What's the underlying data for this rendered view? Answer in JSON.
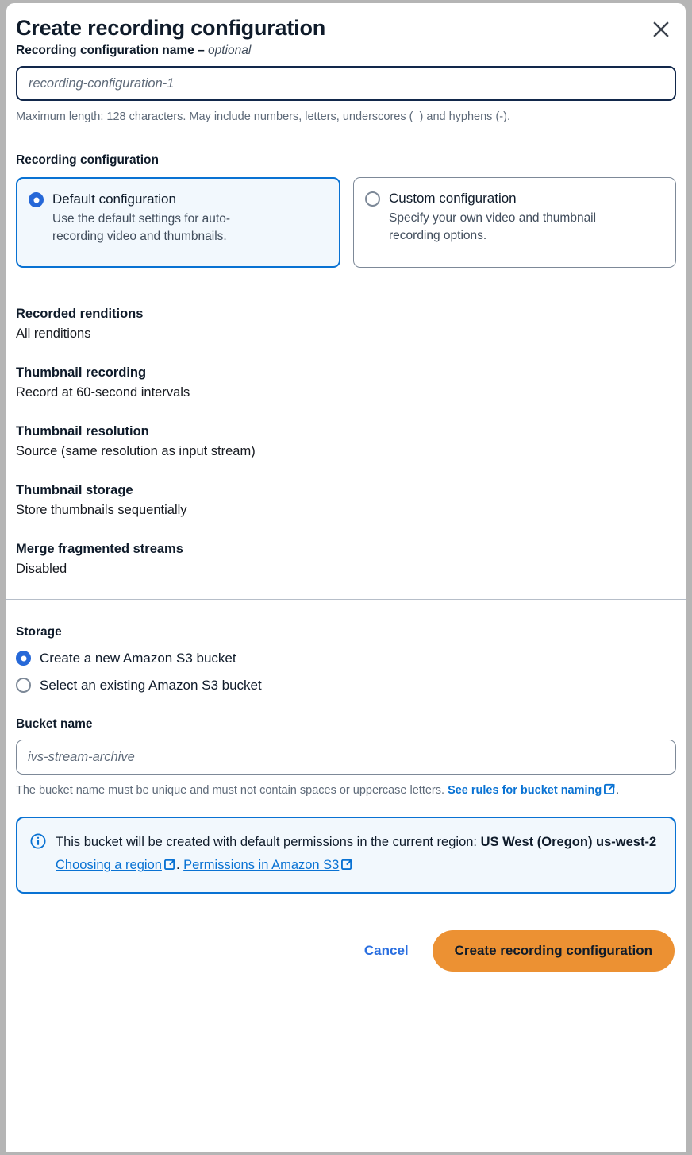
{
  "dialog": {
    "title": "Create recording configuration",
    "close_icon": "close-icon"
  },
  "name_field": {
    "label": "Recording configuration name – ",
    "optional_suffix": "optional",
    "placeholder": "recording-configuration-1",
    "value": "",
    "hint": "Maximum length: 128 characters. May include numbers, letters, underscores (_) and hyphens (-)."
  },
  "recording_configuration": {
    "section_title": "Recording configuration",
    "options": [
      {
        "title": "Default configuration",
        "description": "Use the default settings for auto-recording video and thumbnails.",
        "selected": true
      },
      {
        "title": "Custom configuration",
        "description": "Specify your own video and thumbnail recording options.",
        "selected": false
      }
    ]
  },
  "summary": [
    {
      "label": "Recorded renditions",
      "value": "All renditions"
    },
    {
      "label": "Thumbnail recording",
      "value": "Record at 60-second intervals"
    },
    {
      "label": "Thumbnail resolution",
      "value": "Source (same resolution as input stream)"
    },
    {
      "label": "Thumbnail storage",
      "value": "Store thumbnails sequentially"
    },
    {
      "label": "Merge fragmented streams",
      "value": "Disabled"
    }
  ],
  "storage": {
    "section_title": "Storage",
    "options": [
      {
        "label": "Create a new Amazon S3 bucket",
        "selected": true
      },
      {
        "label": "Select an existing Amazon S3 bucket",
        "selected": false
      }
    ]
  },
  "bucket_field": {
    "label": "Bucket name",
    "placeholder": "ivs-stream-archive",
    "value": "",
    "hint_text": "The bucket name must be unique and must not contain spaces or uppercase letters. ",
    "hint_link": "See rules for bucket naming",
    "hint_tail": "."
  },
  "alert": {
    "icon": "info-circle-icon",
    "text_before": "This bucket will be created with default permissions in the current region: ",
    "region": "US West (Oregon) us-west-2",
    "link_region": "Choosing a region",
    "separator": ". ",
    "link_permissions": "Permissions in Amazon S3"
  },
  "footer": {
    "cancel_label": "Cancel",
    "submit_label": "Create recording configuration"
  },
  "colors": {
    "accent_blue": "#0972d3",
    "primary_orange": "#ec9133",
    "focus_navy": "#12284b",
    "alert_bg": "#f2f8fd",
    "text_dark": "#0f1b2a",
    "text_muted": "#5f6b7a"
  }
}
